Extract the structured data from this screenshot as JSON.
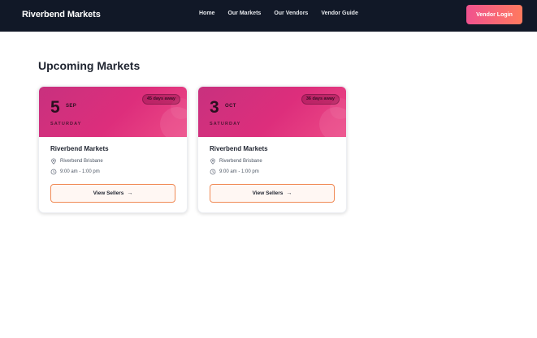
{
  "nav": {
    "brand": "Riverbend Markets",
    "links": [
      "Home",
      "Our Markets",
      "Our Vendors",
      "Vendor Guide"
    ],
    "login_label": "Vendor Login"
  },
  "main": {
    "title": "Upcoming Markets",
    "cards": [
      {
        "day": "5",
        "month": "SEP",
        "weekday": "SATURDAY",
        "badge": "45 days away",
        "name": "Riverbend Markets",
        "location": "Riverbend Brisbane",
        "time": "9:00 am - 1:00 pm",
        "button_label": "View Sellers",
        "button_arrow": "→"
      },
      {
        "day": "3",
        "month": "OCT",
        "weekday": "SATURDAY",
        "badge": "36 days away",
        "name": "Riverbend Markets",
        "location": "Riverbend Brisbane",
        "time": "9:00 am - 1:00 pm",
        "button_label": "View Sellers",
        "button_arrow": "→"
      }
    ]
  },
  "colors": {
    "nav_bg": "#111827",
    "card_gradient_start": "#c8317e",
    "card_gradient_end": "#ed4a86",
    "accent": "#f08a55"
  }
}
